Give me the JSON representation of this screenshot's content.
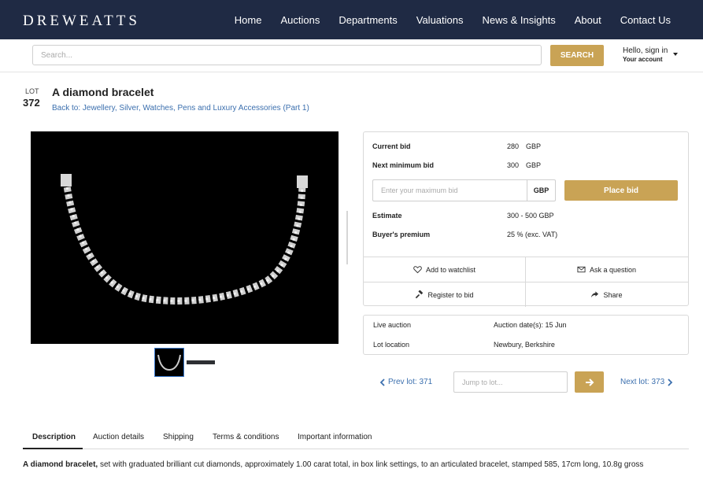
{
  "brand": "DREWEATTS",
  "nav": [
    "Home",
    "Auctions",
    "Departments",
    "Valuations",
    "News & Insights",
    "About",
    "Contact Us"
  ],
  "search": {
    "placeholder": "Search...",
    "button": "SEARCH"
  },
  "account": {
    "greeting": "Hello, sign in",
    "sub": "Your account"
  },
  "lot": {
    "label": "LOT",
    "number": "372",
    "title": "A diamond bracelet",
    "back_link": "Back to: Jewellery, Silver, Watches, Pens and Luxury Accessories (Part 1)"
  },
  "bid": {
    "current_label": "Current bid",
    "current_value": "280",
    "current_currency": "GBP",
    "next_label": "Next minimum bid",
    "next_value": "300",
    "next_currency": "GBP",
    "input_placeholder": "Enter your maximum bid",
    "input_currency": "GBP",
    "place_button": "Place bid",
    "estimate_label": "Estimate",
    "estimate_value": "300 - 500 GBP",
    "premium_label": "Buyer's premium",
    "premium_value": "25 % (exc. VAT)"
  },
  "actions": {
    "watchlist": "Add to watchlist",
    "ask": "Ask a question",
    "register": "Register to bid",
    "share": "Share"
  },
  "info": {
    "type": "Live auction",
    "dates": "Auction date(s): 15 Jun",
    "location_label": "Lot location",
    "location_value": "Newbury, Berkshire"
  },
  "lot_nav": {
    "prev": "Prev lot: 371",
    "jump_placeholder": "Jump to lot...",
    "next": "Next lot: 373"
  },
  "tabs": [
    "Description",
    "Auction details",
    "Shipping",
    "Terms & conditions",
    "Important information"
  ],
  "description": {
    "lead": "A diamond bracelet,",
    "text": " set with graduated brilliant cut diamonds, approximately 1.00 carat total, in box link settings, to an articulated bracelet, stamped 585, 17cm long, 10.8g gross"
  },
  "colors": {
    "header": "#1f2a44",
    "accent": "#c9a355",
    "link": "#3b6fae"
  }
}
